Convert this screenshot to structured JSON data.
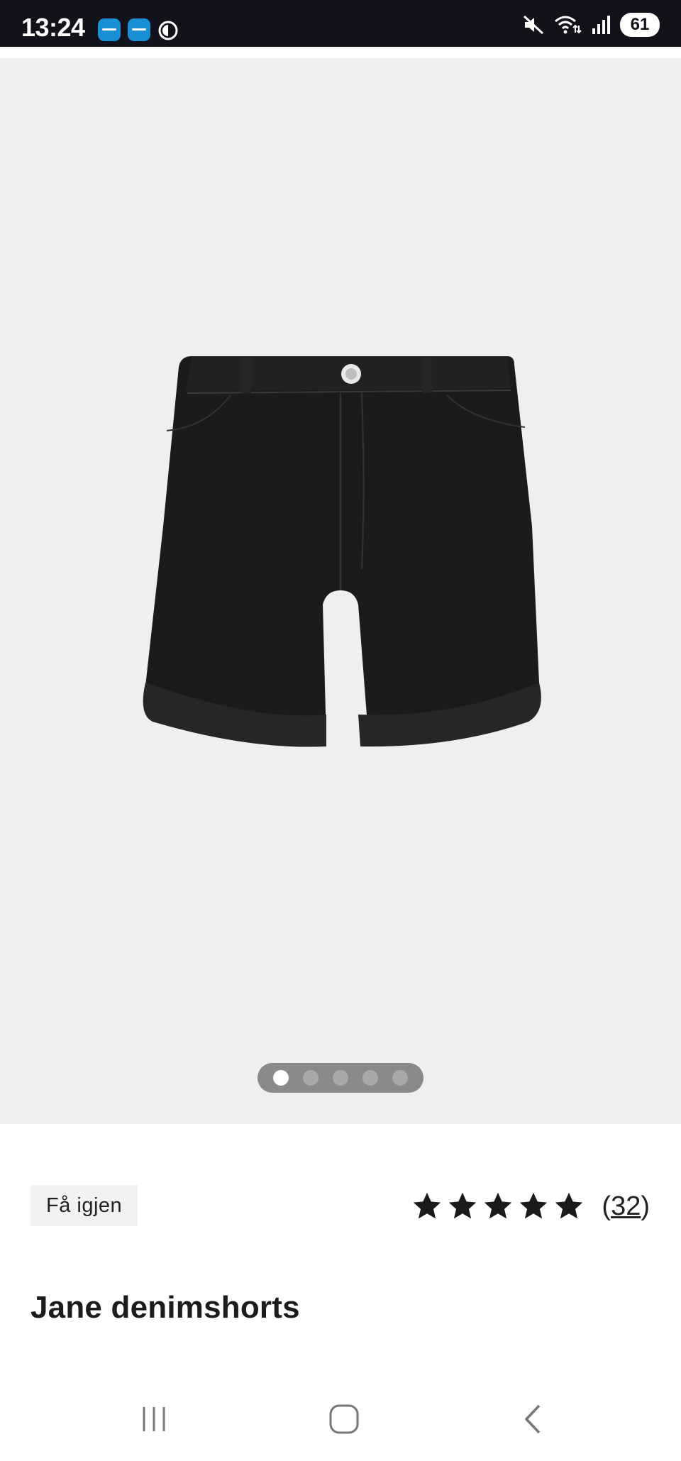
{
  "status_bar": {
    "time": "13:24",
    "battery": "61",
    "notification_icons": [
      "app-icon",
      "app-icon",
      "circle-half-icon"
    ],
    "system_icons": [
      "mute-icon",
      "wifi-icon",
      "signal-icon"
    ]
  },
  "gallery": {
    "image": "black-denim-shorts",
    "page_count": 5,
    "active_page": 1
  },
  "product": {
    "tag_label": "Få igjen",
    "rating_stars": 5,
    "rating_value_fraction": 0.98,
    "rating_count_open": "(",
    "rating_count": "32",
    "rating_count_close": ")",
    "title": "Jane denimshorts"
  },
  "navigation": {
    "buttons": [
      "recent-apps-icon",
      "home-icon",
      "back-icon"
    ]
  },
  "colors": {
    "status_bar_bg": "#12131a",
    "gallery_bg": "#f0efef",
    "star": "#1a1a1a",
    "text": "#1c1c1c"
  }
}
